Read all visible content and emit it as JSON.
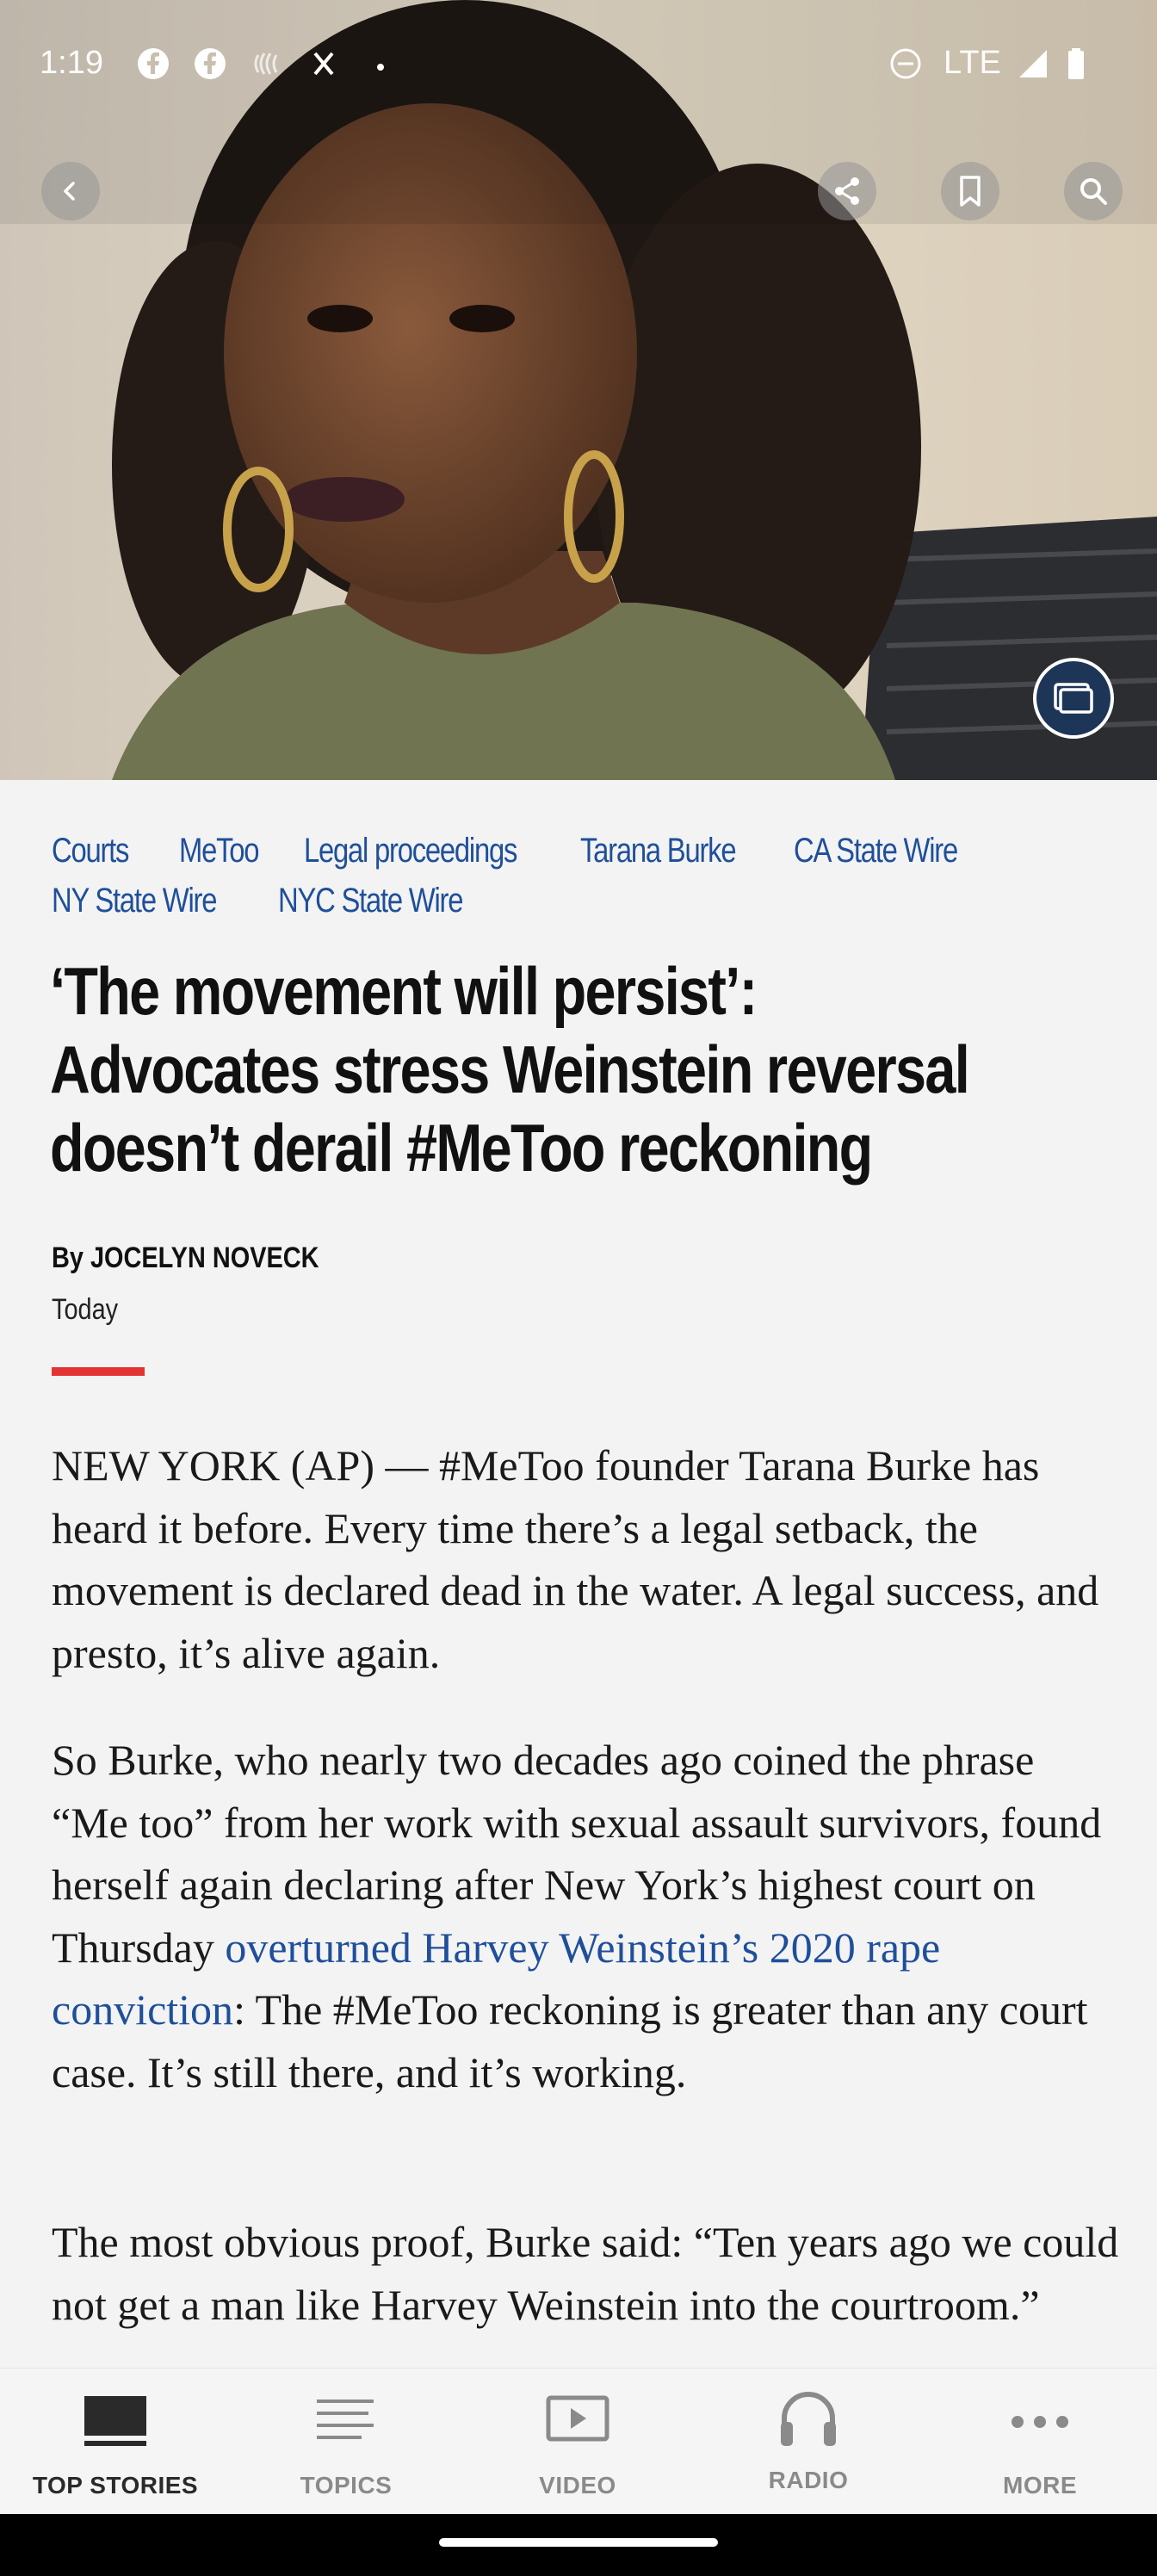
{
  "status_bar": {
    "time": "1:19",
    "network": "LTE",
    "icons": [
      "facebook-icon",
      "facebook-icon",
      "nfc-icon",
      "x-icon",
      "dot-icon",
      "do-not-disturb-icon",
      "signal-icon",
      "battery-icon"
    ]
  },
  "hero": {
    "buttons": [
      "back-icon",
      "share-icon",
      "bookmark-icon",
      "search-icon",
      "gallery-icon"
    ]
  },
  "tags": [
    "Courts",
    "MeToo",
    "Legal proceedings",
    "Tarana Burke",
    "CA State Wire",
    "NY State Wire",
    "NYC State Wire"
  ],
  "article": {
    "headline": "‘The movement will persist’: Advocates stress Weinstein reversal doesn’t derail #MeToo reckoning",
    "byline": "By JOCELYN NOVECK",
    "date": "Today",
    "accent_color": "#e33333",
    "link_color": "#1f4f9a",
    "para1": "NEW YORK (AP) — #MeToo founder Tarana Burke has heard it before. Every time there’s a legal setback, the movement is declared dead in the water. A legal success, and presto, it’s alive again.",
    "para2_before": "So Burke, who nearly two decades ago coined the phrase “Me too” from her work with sexual assault survivors, found herself again declaring after New York’s highest court on Thursday ",
    "para2_link": "overturned Harvey Weinstein’s 2020 rape conviction",
    "para2_after": ": The #MeToo reckoning is greater than any court case. It’s still there, and it’s working.",
    "para3": "The most obvious proof, Burke said: “Ten years ago we could not get a man like Harvey Weinstein into the courtroom.”"
  },
  "bottom_nav": {
    "items": [
      {
        "label": "TOP STORIES",
        "icon": "top-stories-icon",
        "active": true
      },
      {
        "label": "TOPICS",
        "icon": "topics-icon",
        "active": false
      },
      {
        "label": "VIDEO",
        "icon": "video-icon",
        "active": false
      },
      {
        "label": "RADIO",
        "icon": "headphones-icon",
        "active": false
      },
      {
        "label": "MORE",
        "icon": "more-icon",
        "active": false
      }
    ]
  }
}
